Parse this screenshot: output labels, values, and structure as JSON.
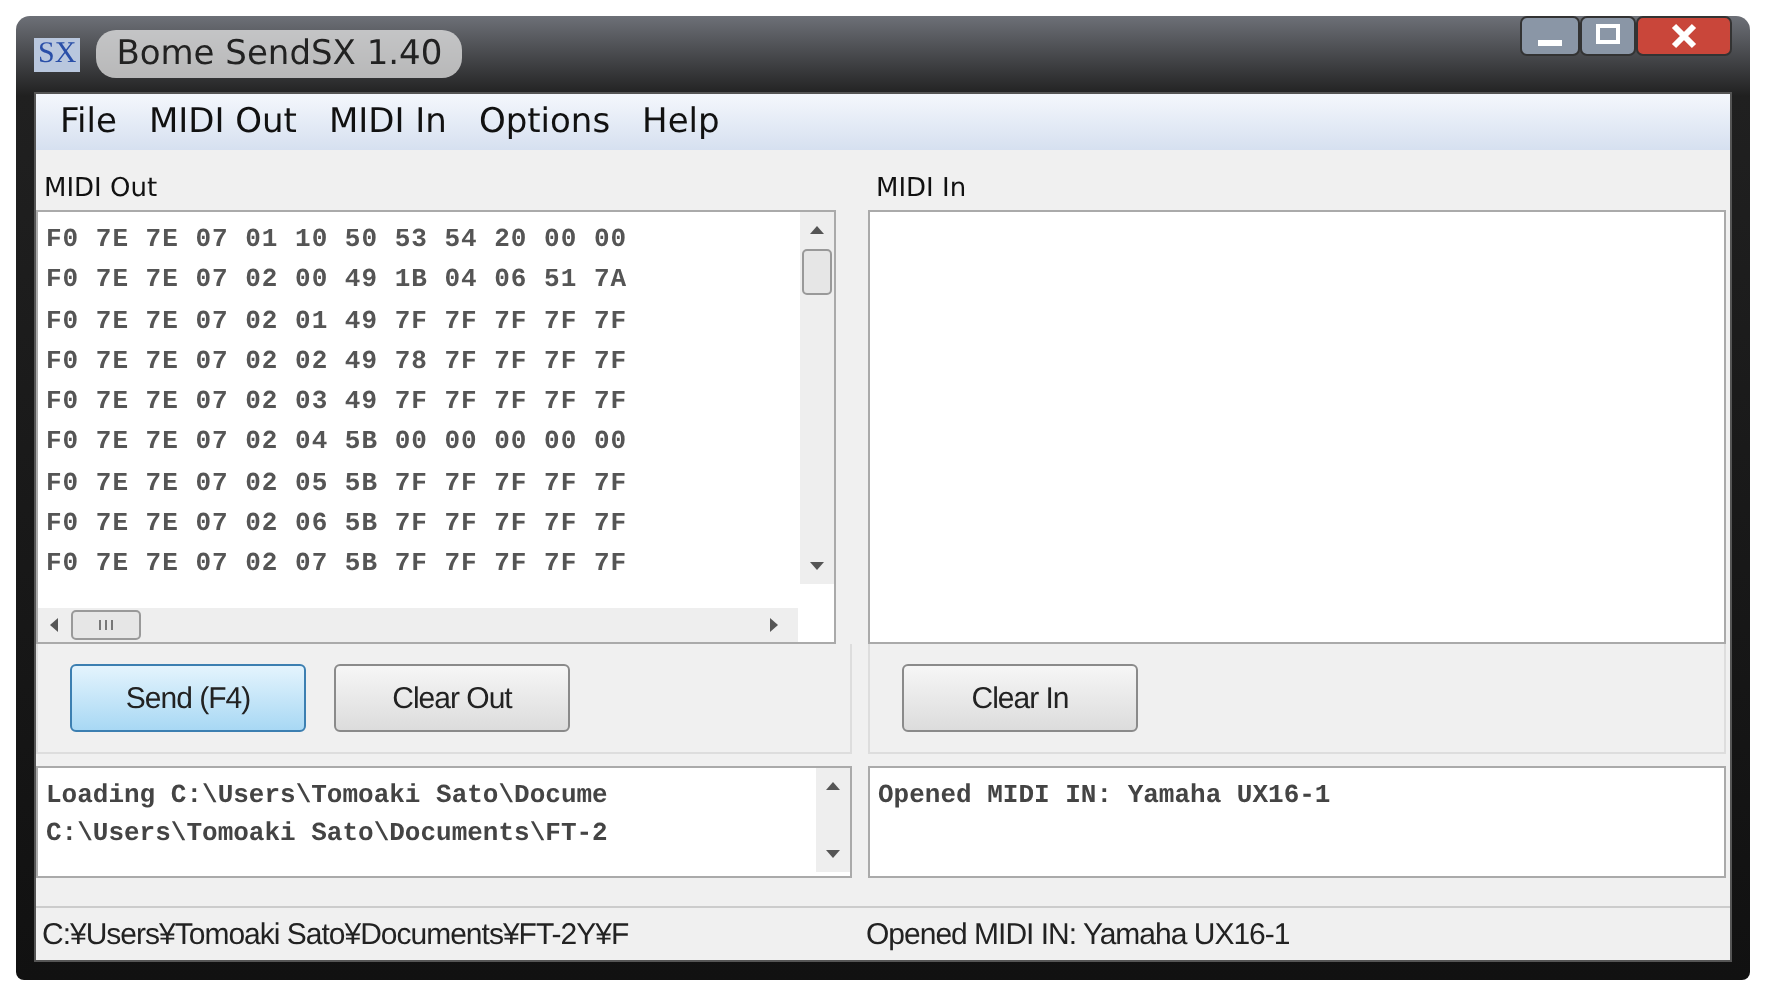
{
  "window": {
    "title": "Bome SendSX 1.40",
    "app_icon": "SX"
  },
  "menu": [
    "File",
    "MIDI Out",
    "MIDI In",
    "Options",
    "Help"
  ],
  "midi_out": {
    "label": "MIDI Out",
    "lines": [
      "F0 7E 7E 07 01 10 50 53 54 20 00 00",
      "F0 7E 7E 07 02 00 49 1B 04 06 51 7A",
      "F0 7E 7E 07 02 01 49 7F 7F 7F 7F 7F",
      "F0 7E 7E 07 02 02 49 78 7F 7F 7F 7F",
      "F0 7E 7E 07 02 03 49 7F 7F 7F 7F 7F",
      "F0 7E 7E 07 02 04 5B 00 00 00 00 00",
      "F0 7E 7E 07 02 05 5B 7F 7F 7F 7F 7F",
      "F0 7E 7E 07 02 06 5B 7F 7F 7F 7F 7F",
      "F0 7E 7E 07 02 07 5B 7F 7F 7F 7F 7F"
    ],
    "buttons": [
      {
        "label": "Send (F4)",
        "focused": true
      },
      {
        "label": "Clear Out",
        "focused": false
      }
    ],
    "log": [
      "Loading C:\\Users\\Tomoaki Sato\\Docume",
      "C:\\Users\\Tomoaki Sato\\Documents\\FT-2"
    ]
  },
  "midi_in": {
    "label": "MIDI In",
    "buttons": [
      {
        "label": "Clear In",
        "focused": false
      }
    ],
    "log": [
      "Opened MIDI IN: Yamaha UX16-1"
    ]
  },
  "status_bar": [
    "C:¥Users¥Tomoaki Sato¥Documents¥FT-2Y¥F",
    "Opened MIDI IN: Yamaha UX16-1"
  ]
}
